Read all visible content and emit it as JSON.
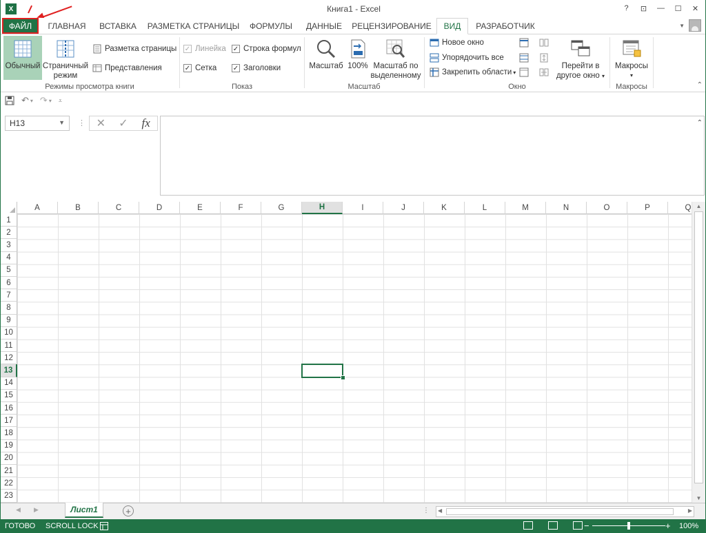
{
  "window": {
    "title": "Книга1 - Excel",
    "logo": "X",
    "buttons": [
      "?",
      "⊡",
      "—",
      "☐",
      "✕"
    ]
  },
  "tabs": [
    "ФАЙЛ",
    "ГЛАВНАЯ",
    "ВСТАВКА",
    "РАЗМЕТКА СТРАНИЦЫ",
    "ФОРМУЛЫ",
    "ДАННЫЕ",
    "РЕЦЕНЗИРОВАНИЕ",
    "ВИД",
    "РАЗРАБОТЧИК"
  ],
  "active_tab": "ВИД",
  "ribbon": {
    "group_views": {
      "label": "Режимы просмотра книги",
      "normal_label": "Обычный",
      "page_line1": "Страничный",
      "page_line2": "режим",
      "layout_label": "Разметка страницы",
      "custom_label": "Представления"
    },
    "group_show": {
      "label": "Показ",
      "ruler": "Линейка",
      "formula_bar": "Строка формул",
      "gridlines": "Сетка",
      "headings": "Заголовки"
    },
    "group_zoom": {
      "label": "Масштаб",
      "zoom_label": "Масштаб",
      "zoom100_label": "100%",
      "sel_line1": "Масштаб по",
      "sel_line2": "выделенному"
    },
    "group_window": {
      "label": "Окно",
      "new_window": "Новое окно",
      "arrange_all": "Упорядочить все",
      "freeze": "Закрепить области",
      "switch_line1": "Перейти в",
      "switch_line2": "другое окно"
    },
    "group_macros": {
      "label": "Макросы",
      "macros_label": "Макросы"
    }
  },
  "qat": {
    "save_icon": "save-icon",
    "undo_icon": "undo-icon",
    "redo_icon": "redo-icon"
  },
  "formula_bar": {
    "name_box": "H13",
    "fx": "fx",
    "cancel": "✕",
    "enter": "✓",
    "value": ""
  },
  "columns": [
    "A",
    "B",
    "C",
    "D",
    "E",
    "F",
    "G",
    "H",
    "I",
    "J",
    "K",
    "L",
    "M",
    "N",
    "O",
    "P",
    "Q"
  ],
  "rows": [
    "1",
    "2",
    "3",
    "4",
    "5",
    "6",
    "7",
    "8",
    "9",
    "10",
    "11",
    "12",
    "13",
    "14",
    "15",
    "16",
    "17",
    "18",
    "19",
    "20",
    "21",
    "22",
    "23"
  ],
  "selected_col": "H",
  "selected_row": "13",
  "sheet_tab": "Лист1",
  "status": {
    "ready": "ГОТОВО",
    "scroll_lock": "SCROLL LOCK",
    "zoom": "100%"
  },
  "colors": {
    "accent": "#217346",
    "annotation": "#e02020"
  }
}
